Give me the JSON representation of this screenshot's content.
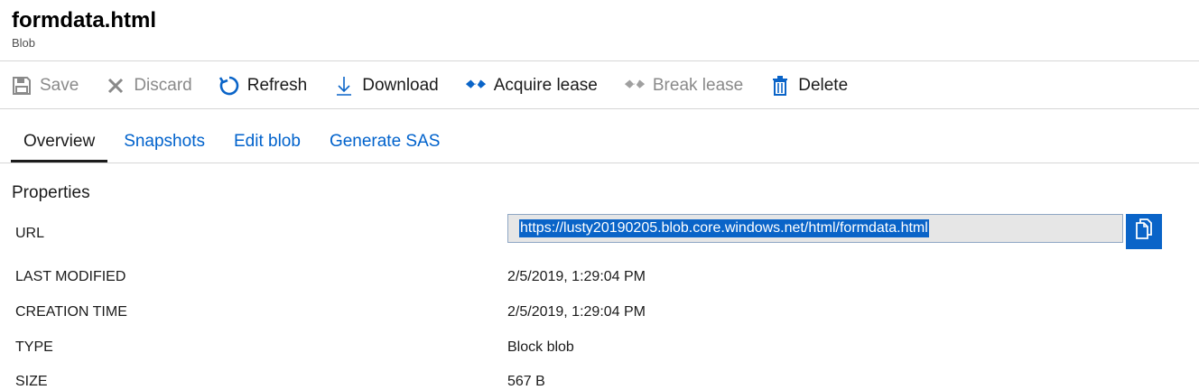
{
  "header": {
    "title": "formdata.html",
    "subtitle": "Blob"
  },
  "toolbar": {
    "save": "Save",
    "discard": "Discard",
    "refresh": "Refresh",
    "download": "Download",
    "acquire_lease": "Acquire lease",
    "break_lease": "Break lease",
    "delete": "Delete"
  },
  "tabs": [
    "Overview",
    "Snapshots",
    "Edit blob",
    "Generate SAS"
  ],
  "properties": {
    "title": "Properties",
    "url_label": "URL",
    "url_value": "https://lusty20190205.blob.core.windows.net/html/formdata.html",
    "last_modified_label": "LAST MODIFIED",
    "last_modified_value": "2/5/2019, 1:29:04 PM",
    "creation_time_label": "CREATION TIME",
    "creation_time_value": "2/5/2019, 1:29:04 PM",
    "type_label": "TYPE",
    "type_value": "Block blob",
    "size_label": "SIZE",
    "size_value": "567 B"
  },
  "colors": {
    "accent": "#0a64c8",
    "link": "#0062cc",
    "disabled": "#8a8a8a"
  }
}
